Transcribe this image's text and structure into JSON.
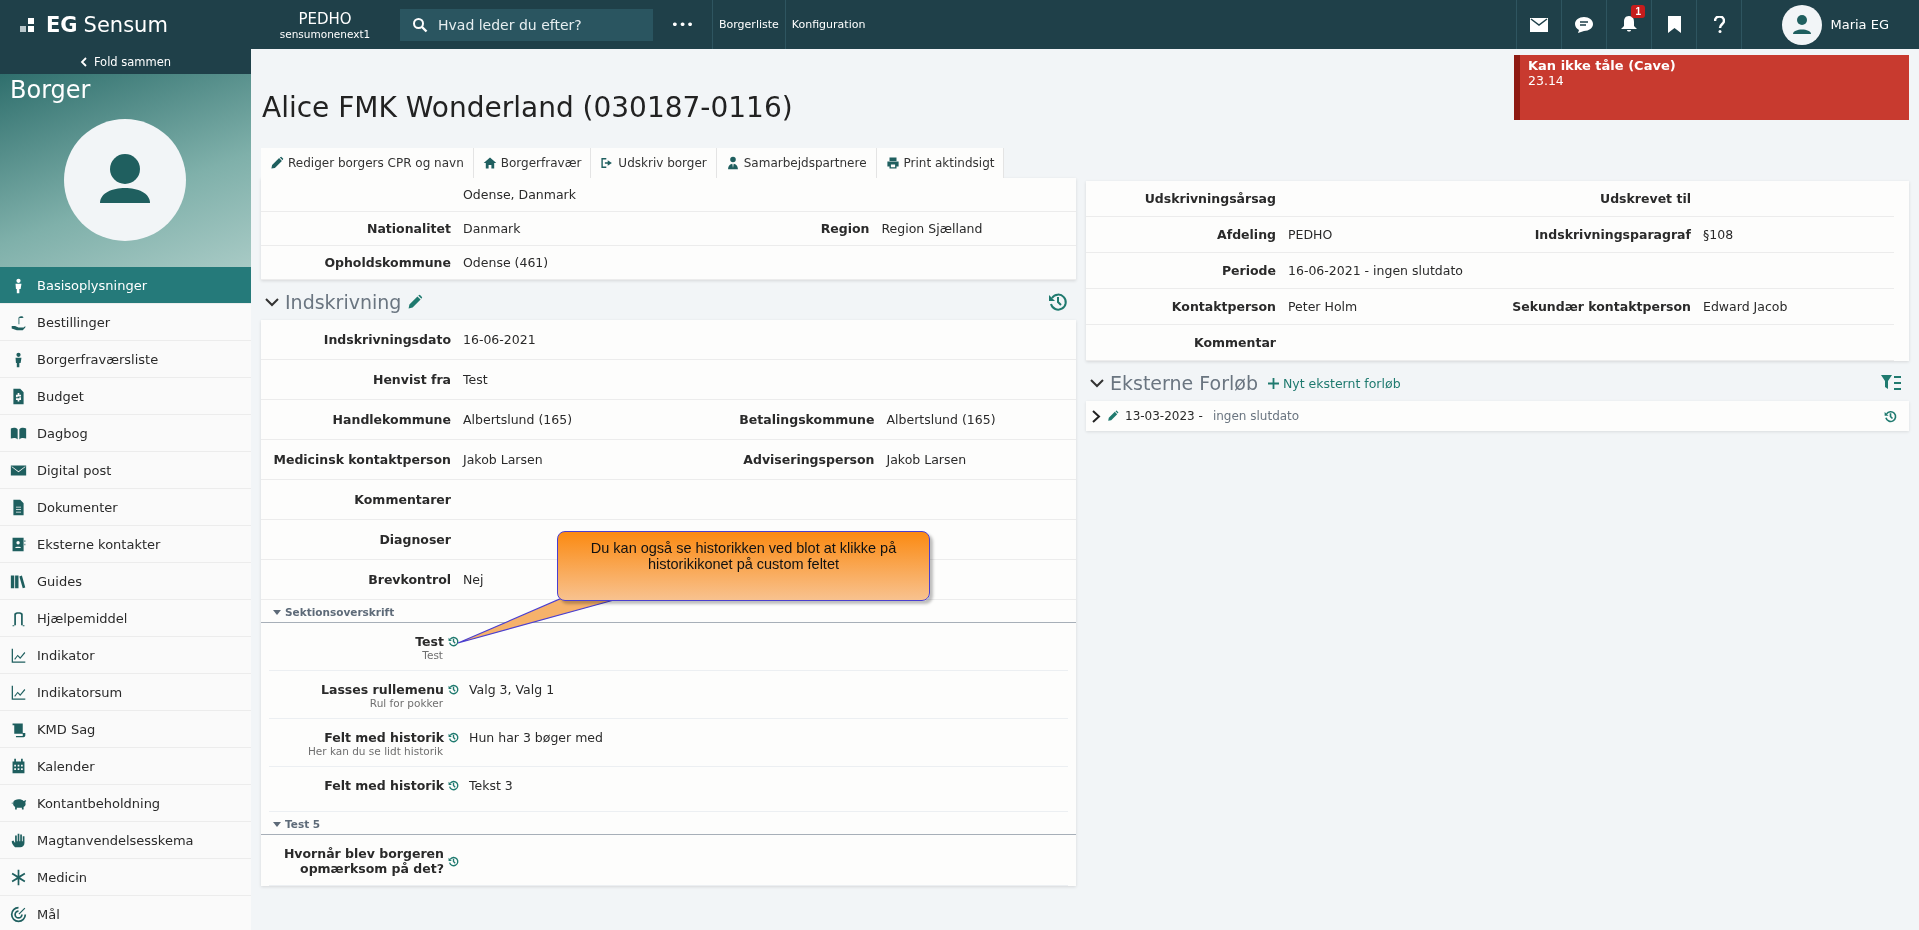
{
  "topbar": {
    "logo": {
      "brand": "EG",
      "product": "Sensum"
    },
    "org": {
      "name": "PEDHO",
      "subtitle": "sensumonenext1"
    },
    "search": {
      "placeholder": "Hvad leder du efter?"
    },
    "more": "•••",
    "links": [
      "Borgerliste",
      "Konfiguration"
    ],
    "notification_count": "1",
    "user": "Maria EG"
  },
  "sidebar": {
    "collapse": "Fold sammen",
    "title": "Borger",
    "items": [
      {
        "label": "Basisoplysninger",
        "selected": true
      },
      {
        "label": "Bestillinger",
        "selected": false
      },
      {
        "label": "Borgerfraværsliste",
        "selected": false
      },
      {
        "label": "Budget",
        "selected": false
      },
      {
        "label": "Dagbog",
        "selected": false
      },
      {
        "label": "Digital post",
        "selected": false
      },
      {
        "label": "Dokumenter",
        "selected": false
      },
      {
        "label": "Eksterne kontakter",
        "selected": false
      },
      {
        "label": "Guides",
        "selected": false
      },
      {
        "label": "Hjælpemiddel",
        "selected": false
      },
      {
        "label": "Indikator",
        "selected": false
      },
      {
        "label": "Indikatorsum",
        "selected": false
      },
      {
        "label": "KMD Sag",
        "selected": false
      },
      {
        "label": "Kalender",
        "selected": false
      },
      {
        "label": "Kontantbeholdning",
        "selected": false
      },
      {
        "label": "Magtanvendelsesskema",
        "selected": false
      },
      {
        "label": "Medicin",
        "selected": false
      },
      {
        "label": "Mål",
        "selected": false
      }
    ]
  },
  "page_title": "Alice FMK Wonderland (030187-0116)",
  "alert": {
    "title": "Kan ikke tåle (Cave)",
    "text": "23.14"
  },
  "toolbar": [
    "Rediger borgers CPR og navn",
    "Borgerfravær",
    "Udskriv borger",
    "Samarbejdspartnere",
    "Print aktindsigt"
  ],
  "left": {
    "top_card": [
      {
        "value": "Odense, Danmark"
      },
      {
        "label": "Nationalitet",
        "value": "Danmark",
        "label2": "Region",
        "value2": "Region Sjælland"
      },
      {
        "label": "Opholdskommune",
        "value": "Odense (461)"
      }
    ],
    "section": {
      "title": "Indskrivning",
      "rows": [
        {
          "label": "Indskrivningsdato",
          "value": "16-06-2021"
        },
        {
          "label": "Henvist fra",
          "value": "Test"
        },
        {
          "label": "Handlekommune",
          "value": "Albertslund (165)",
          "label2": "Betalingskommune",
          "value2": "Albertslund (165)"
        },
        {
          "label": "Medicinsk kontaktperson",
          "value": "Jakob Larsen",
          "label2": "Adviseringsperson",
          "value2": "Jakob Larsen"
        },
        {
          "label": "Kommentarer"
        },
        {
          "label": "Diagnoser"
        },
        {
          "label": "Brevkontrol",
          "value": "Nej"
        }
      ],
      "subsections": [
        {
          "title": "Sektionsoverskrift",
          "fields": [
            {
              "label": "Test",
              "hint": "Test"
            },
            {
              "label": "Lasses rullemenu",
              "hint": "Rul for pokker",
              "value": "Valg 3, Valg 1"
            },
            {
              "label": "Felt med historik",
              "hint": "Her kan du se lidt historik",
              "value": "Hun har 3 bøger med"
            },
            {
              "label": "Felt med historik",
              "value": "Tekst 3"
            }
          ]
        },
        {
          "title": "Test 5",
          "fields": [
            {
              "label": "Hvornår blev borgeren opmærksom på det?"
            }
          ]
        }
      ]
    }
  },
  "right": {
    "card": [
      {
        "label": "Udskrivningsårsag",
        "label2": "Udskrevet til"
      },
      {
        "label": "Afdeling",
        "value": "PEDHO",
        "label2": "Indskrivningsparagraf",
        "value2": "§108"
      },
      {
        "label": "Periode",
        "value": "16-06-2021 - ingen slutdato"
      },
      {
        "label": "Kontaktperson",
        "value": "Peter Holm",
        "label2": "Sekundær kontaktperson",
        "value2": "Edward Jacob"
      },
      {
        "label": "Kommentar"
      }
    ],
    "external": {
      "title": "Eksterne Forløb",
      "add": "Nyt eksternt forløb",
      "items": [
        {
          "start": "13-03-2023 -",
          "end": "ingen slutdato"
        }
      ]
    }
  },
  "callout": "Du kan også se historikken ved blot at klikke på historikikonet på custom feltet"
}
